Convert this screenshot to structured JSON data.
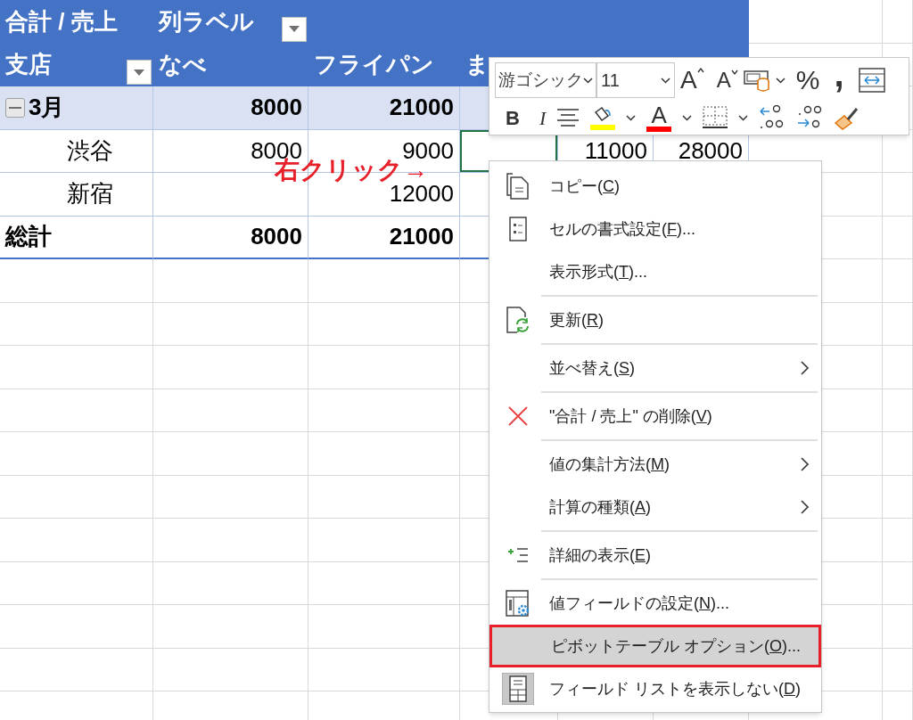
{
  "sheet": {
    "rows": [
      {
        "kind": "header",
        "cells": [
          {
            "text": "合計 / 売上"
          },
          {
            "text": "列ラベル",
            "filter": true
          }
        ]
      },
      {
        "kind": "header",
        "cells": [
          {
            "text": "支店",
            "filter": true
          },
          {
            "text": "なべ"
          },
          {
            "text": "フライパン"
          },
          {
            "text": "ま"
          }
        ]
      },
      {
        "kind": "subtotal",
        "cells": [
          {
            "text": "3月",
            "expanded": true
          },
          {
            "text": "8000"
          },
          {
            "text": "21000"
          }
        ]
      },
      {
        "kind": "data",
        "cells": [
          {
            "text": "渋谷"
          },
          {
            "text": "8000"
          },
          {
            "text": "9000"
          },
          {
            "selected": true
          },
          {
            "text": "11000"
          },
          {
            "text": "28000"
          }
        ]
      },
      {
        "kind": "data",
        "cells": [
          {
            "text": "新宿"
          },
          null,
          {
            "text": "12000"
          }
        ]
      },
      {
        "kind": "total",
        "cells": [
          {
            "text": "総計"
          },
          {
            "text": "8000"
          },
          {
            "text": "21000"
          }
        ]
      }
    ]
  },
  "annotation": "右クリック→",
  "toolbar": {
    "font": "游ゴシック",
    "size": "11",
    "grow_label": "A",
    "shrink_label": "A",
    "percent": "%",
    "comma": ",",
    "bold": "B",
    "italic": "I",
    "font_color_label": "A"
  },
  "menu": [
    {
      "kind": "copy",
      "label": "コピー(",
      "key": "C",
      "suffix": ")",
      "submenu": false,
      "selected": false
    },
    {
      "kind": "format",
      "label": "セルの書式設定(",
      "key": "F",
      "suffix": ")...",
      "submenu": false,
      "selected": false
    },
    {
      "kind": "plain",
      "label": "表示形式(",
      "key": "T",
      "suffix": ")...",
      "submenu": false,
      "selected": false
    },
    {
      "kind": "separator"
    },
    {
      "kind": "refresh",
      "label": "更新(",
      "key": "R",
      "suffix": ")",
      "submenu": false,
      "selected": false
    },
    {
      "kind": "separator"
    },
    {
      "kind": "plain",
      "label": "並べ替え(",
      "key": "S",
      "suffix": ")",
      "submenu": true,
      "selected": false
    },
    {
      "kind": "separator"
    },
    {
      "kind": "remove",
      "label": "\"合計 / 売上\" の削除(",
      "key": "V",
      "suffix": ")",
      "submenu": false,
      "selected": false
    },
    {
      "kind": "separator"
    },
    {
      "kind": "plain",
      "label": "値の集計方法(",
      "key": "M",
      "suffix": ")",
      "submenu": true,
      "selected": false
    },
    {
      "kind": "plain",
      "label": "計算の種類(",
      "key": "A",
      "suffix": ")",
      "submenu": true,
      "selected": false
    },
    {
      "kind": "separator"
    },
    {
      "kind": "details",
      "label": "詳細の表示(",
      "key": "E",
      "suffix": ")",
      "submenu": false,
      "selected": false
    },
    {
      "kind": "separator"
    },
    {
      "kind": "field-settings",
      "label": "値フィールドの設定(",
      "key": "N",
      "suffix": ")...",
      "submenu": false,
      "selected": false
    },
    {
      "kind": "plain",
      "label": "ピボットテーブル オプション(",
      "key": "O",
      "suffix": ")...",
      "submenu": false,
      "selected": true
    },
    {
      "kind": "field-list",
      "label": "フィールド リストを表示しない(",
      "key": "D",
      "suffix": ")",
      "submenu": false,
      "selected": false
    }
  ]
}
